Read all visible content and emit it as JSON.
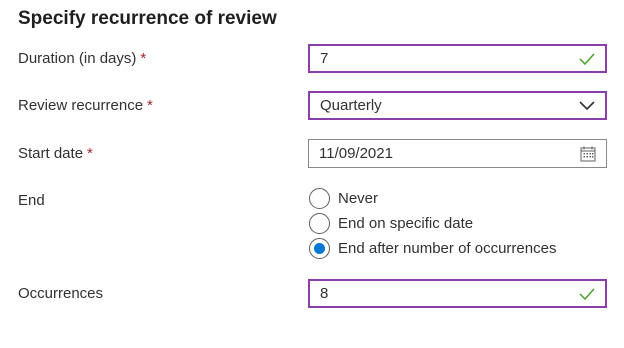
{
  "title": "Specify recurrence of review",
  "required_marker": "*",
  "duration": {
    "label": "Duration (in days)",
    "value": "7"
  },
  "recurrence": {
    "label": "Review recurrence",
    "value": "Quarterly"
  },
  "start_date": {
    "label": "Start date",
    "value": "11/09/2021"
  },
  "end": {
    "label": "End",
    "options": [
      "Never",
      "End on specific date",
      "End after number of occurrences"
    ],
    "selected": "End after number of occurrences"
  },
  "occurrences": {
    "label": "Occurrences",
    "value": "8"
  },
  "colors": {
    "focus_border": "#8a3fa8",
    "check": "#4aa02c",
    "radio_selected": "#0078d4",
    "required": "#a4262c"
  },
  "icons": [
    "checkmark-icon",
    "chevron-down-icon",
    "calendar-icon"
  ]
}
